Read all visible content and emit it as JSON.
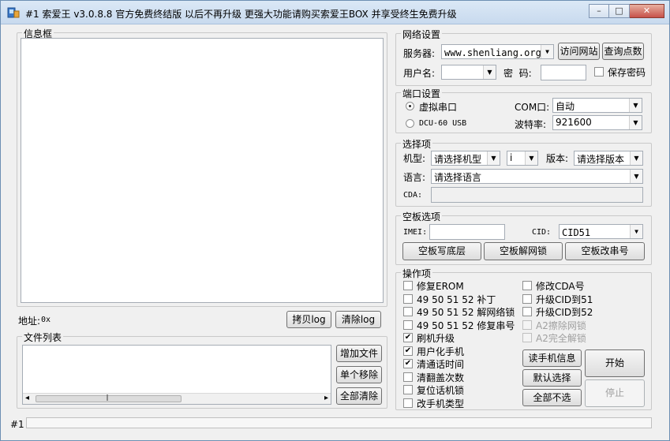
{
  "window": {
    "title": "#1 索爱王 v3.0.8.8  官方免费终结版  以后不再升级  更强大功能请购买索爱王BOX  并享受终生免费升级",
    "minimize_glyph": "–",
    "maximize_glyph": "□",
    "close_glyph": "✕"
  },
  "info_box": {
    "label": "信息框"
  },
  "address": {
    "label": "地址:",
    "value": "0x"
  },
  "log_buttons": {
    "copy": "拷贝log",
    "clear": "清除log"
  },
  "file_list": {
    "label": "文件列表",
    "add": "增加文件",
    "remove": "单个移除",
    "clear_all": "全部清除",
    "scroll_left": "◂",
    "scroll_right": "▸",
    "grip": "‖"
  },
  "network": {
    "label": "网络设置",
    "server_label": "服务器:",
    "server_value": "www.shenliang.org",
    "visit_site": "访问网站",
    "query_points": "查询点数",
    "username_label": "用户名:",
    "username_value": "",
    "password_label": "密  码:",
    "password_value": "",
    "save_password": "保存密码"
  },
  "port": {
    "label": "端口设置",
    "virtual_serial": "虚拟串口",
    "dcu_usb": "DCU-60 USB",
    "com_label": "COM口:",
    "com_value": "自动",
    "baud_label": "波特率:",
    "baud_value": "921600"
  },
  "select": {
    "label": "选择项",
    "model_label": "机型:",
    "model_value": "请选择机型",
    "i_value": "i",
    "version_label": "版本:",
    "version_value": "请选择版本",
    "language_label": "语言:",
    "language_value": "请选择语言",
    "cda_label": "CDA:",
    "cda_value": ""
  },
  "blank_board": {
    "label": "空板选项",
    "imei_label": "IMEI:",
    "imei_value": "",
    "cid_label": "CID:",
    "cid_value": "CID51",
    "write_bottom": "空板写底层",
    "unlock_net": "空板解网锁",
    "change_serial": "空板改串号"
  },
  "operations": {
    "label": "操作项",
    "left": [
      {
        "label": "修复EROM",
        "checked": false
      },
      {
        "label": "49 50 51 52 补丁",
        "checked": false
      },
      {
        "label": "49 50 51 52 解网络锁",
        "checked": false
      },
      {
        "label": "49 50 51 52 修复串号",
        "checked": false
      },
      {
        "label": "刷机升级",
        "checked": true
      },
      {
        "label": "用户化手机",
        "checked": true
      },
      {
        "label": "清通话时间",
        "checked": true
      },
      {
        "label": "清翻盖次数",
        "checked": false
      },
      {
        "label": "复位话机锁",
        "checked": false
      },
      {
        "label": "改手机类型",
        "checked": false
      }
    ],
    "right": [
      {
        "label": "修改CDA号",
        "checked": false,
        "disabled": false
      },
      {
        "label": "升级CID到51",
        "checked": false,
        "disabled": false
      },
      {
        "label": "升级CID到52",
        "checked": false,
        "disabled": false
      },
      {
        "label": "A2擦除网锁",
        "checked": false,
        "disabled": true
      },
      {
        "label": "A2完全解锁",
        "checked": false,
        "disabled": true
      }
    ],
    "read_info": "读手机信息",
    "default_select": "默认选择",
    "deselect_all": "全部不选",
    "start": "开始",
    "stop": "停止",
    "check_mark": "✔"
  },
  "status": {
    "text": "#1"
  }
}
